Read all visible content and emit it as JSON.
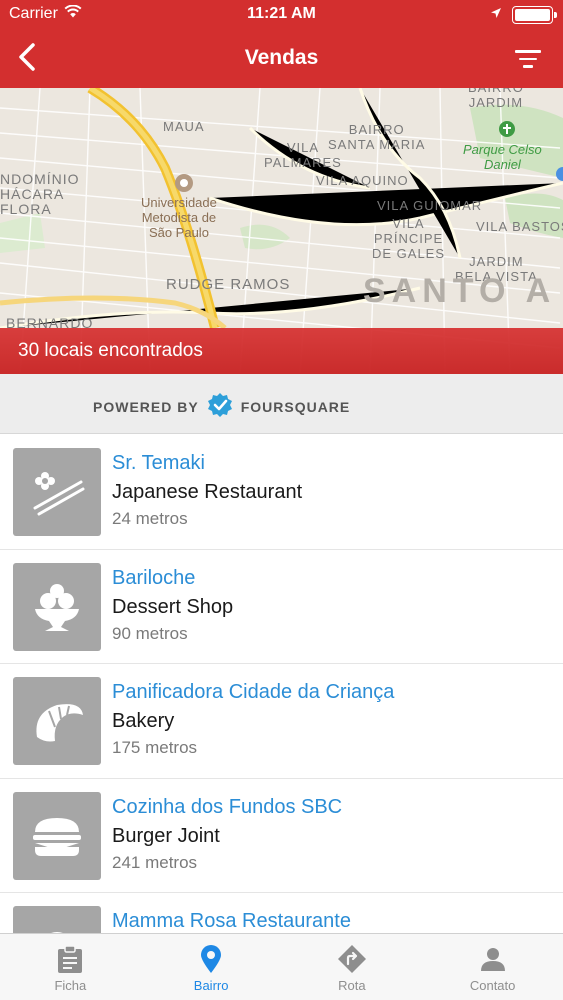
{
  "status_bar": {
    "carrier": "Carrier",
    "time": "11:21 AM"
  },
  "nav": {
    "title": "Vendas"
  },
  "map": {
    "labels": {
      "maua": "MAUA",
      "bairro_jardim": "BAIRRO\nJARDIM",
      "bairro_santa_maria": "BAIRRO\nSANTA MARIA",
      "vila_palmares": "VILA\nPALMARES",
      "parque": "Parque Celso\nDaniel",
      "condominio": "NDOMÍNIO\nHÁCARA\nFLORA",
      "universidade": "Universidade\nMetodista de\nSão Paulo",
      "vila_aquino": "VILA AQUINO",
      "vila_guiomar": "VILA GUIOMAR",
      "vila_bastos": "VILA BASTOS",
      "vila_principe": "VILA\nPRÍNCIPE\nDE GALES",
      "jardim_bela_vista": "JARDIM\nBELA VISTA",
      "rudge_ramos": "RUDGE RAMOS",
      "santo_andre": "SANTO A",
      "bernardo": "BERNARDO"
    },
    "results_text": "30 locais encontrados"
  },
  "powered_by": {
    "prefix": "POWERED BY",
    "brand": "FOURSQUARE"
  },
  "places": [
    {
      "name": "Sr. Temaki",
      "category": "Japanese Restaurant",
      "distance": "24 metros",
      "icon": "sushi-icon"
    },
    {
      "name": "Bariloche",
      "category": "Dessert Shop",
      "distance": "90 metros",
      "icon": "ice-cream-icon"
    },
    {
      "name": "Panificadora Cidade da Criança",
      "category": "Bakery",
      "distance": "175 metros",
      "icon": "croissant-icon"
    },
    {
      "name": "Cozinha dos Fundos SBC",
      "category": "Burger Joint",
      "distance": "241 metros",
      "icon": "burger-icon"
    },
    {
      "name": "Mamma Rosa Restaurante",
      "category": "",
      "distance": "",
      "icon": "restaurant-icon"
    }
  ],
  "tabs": [
    {
      "label": "Ficha",
      "icon": "clipboard-icon",
      "active": false
    },
    {
      "label": "Bairro",
      "icon": "location-pin-icon",
      "active": true
    },
    {
      "label": "Rota",
      "icon": "route-sign-icon",
      "active": false
    },
    {
      "label": "Contato",
      "icon": "person-icon",
      "active": false
    }
  ],
  "colors": {
    "header": "#d32f2f",
    "link": "#2b8dd6",
    "tab_active": "#1e88e5",
    "foursquare": "#2d9fd9"
  }
}
